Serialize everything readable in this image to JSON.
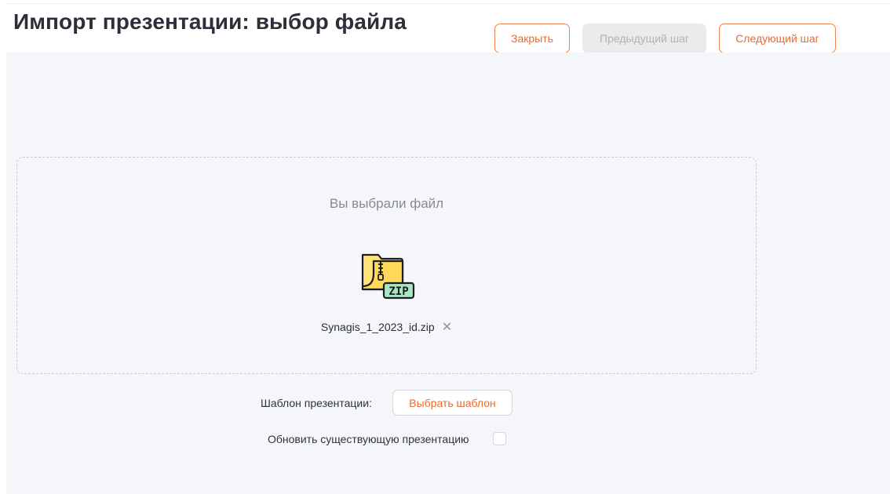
{
  "header": {
    "title": "Импорт презентации: выбор файла",
    "close_label": "Закрыть",
    "prev_label": "Предыдущий шаг",
    "next_label": "Следующий шаг"
  },
  "dropzone": {
    "title": "Вы выбрали файл",
    "file_icon": "zip-file-icon",
    "file_icon_text": "ZIP",
    "filename": "Synagis_1_2023_id.zip",
    "remove_icon": "close-icon"
  },
  "options": {
    "template_label": "Шаблон презентации:",
    "template_button": "Выбрать шаблон",
    "update_label": "Обновить существующую презентацию",
    "update_checked": false
  },
  "colors": {
    "accent": "#ea6a2c",
    "background": "#f5f6fa",
    "disabled_bg": "#ebebeb",
    "title_text": "#2b2f38",
    "zip_folder": "#ffe27a",
    "zip_badge": "#a8e6c4"
  }
}
